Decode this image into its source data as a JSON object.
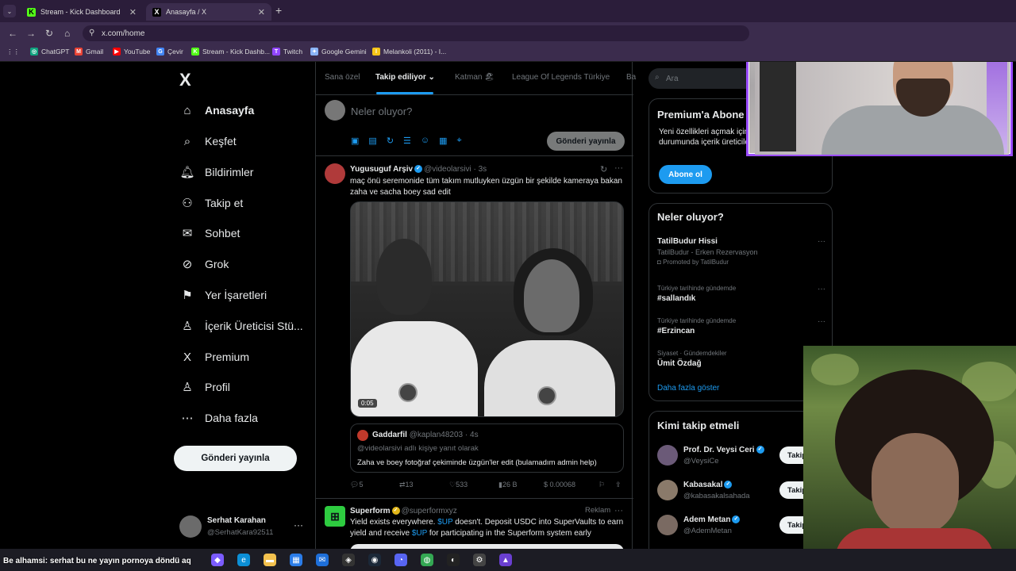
{
  "browser": {
    "tabs": [
      {
        "label": "Stream - Kick Dashboard",
        "fav_text": "K",
        "fav_color": "#53fc18"
      },
      {
        "label": "Anasayfa / X",
        "fav_text": "X",
        "fav_color": "#000000"
      }
    ],
    "new_tab": "+",
    "url": "x.com/home",
    "bookmarks": [
      {
        "label": "ChatGPT",
        "icon": "chatgpt-icon",
        "color": "#10a37f",
        "glyph": "◎"
      },
      {
        "label": "Gmail",
        "icon": "gmail-icon",
        "color": "#ea4335",
        "glyph": "M"
      },
      {
        "label": "YouTube",
        "icon": "youtube-icon",
        "color": "#ff0000",
        "glyph": "▶"
      },
      {
        "label": "Çevir",
        "icon": "translate-icon",
        "color": "#4285f4",
        "glyph": "G"
      },
      {
        "label": "Stream - Kick Dashb...",
        "icon": "kick-icon",
        "color": "#53fc18",
        "glyph": "K"
      },
      {
        "label": "Twitch",
        "icon": "twitch-icon",
        "color": "#9146ff",
        "glyph": "T"
      },
      {
        "label": "Google Gemini",
        "icon": "gemini-icon",
        "color": "#8ab4f8",
        "glyph": "✦"
      },
      {
        "label": "Melankoli (2011) - I...",
        "icon": "imdb-icon",
        "color": "#f5c518",
        "glyph": "I"
      }
    ]
  },
  "sidebar": {
    "logo": "X",
    "items": [
      {
        "label": "Anasayfa",
        "icon": "home-icon",
        "glyph": "⌂",
        "active": true
      },
      {
        "label": "Keşfet",
        "icon": "search-icon",
        "glyph": "⌕"
      },
      {
        "label": "Bildirimler",
        "icon": "bell-icon",
        "glyph": "🔔︎"
      },
      {
        "label": "Takip et",
        "icon": "add-person-icon",
        "glyph": "⚇"
      },
      {
        "label": "Sohbet",
        "icon": "mail-icon",
        "glyph": "✉"
      },
      {
        "label": "Grok",
        "icon": "grok-icon",
        "glyph": "⊘"
      },
      {
        "label": "Yer İşaretleri",
        "icon": "bookmark-icon",
        "glyph": "⚑"
      },
      {
        "label": "İçerik Üreticisi Stü...",
        "icon": "creator-studio-icon",
        "glyph": "♙"
      },
      {
        "label": "Premium",
        "icon": "x-premium-icon",
        "glyph": "X"
      },
      {
        "label": "Profil",
        "icon": "profile-icon",
        "glyph": "♙"
      },
      {
        "label": "Daha fazla",
        "icon": "more-circle-icon",
        "glyph": "⋯"
      }
    ],
    "post_button": "Gönderi yayınla",
    "account": {
      "name": "Serhat Karahan",
      "handle": "@SerhatKara92511"
    }
  },
  "timeline": {
    "tabs": [
      "Sana özel",
      "Takip ediliyor",
      "Katman 🏖",
      "League Of Legends Türkiye",
      "Ba"
    ],
    "active_tab": "Takip ediliyor",
    "compose": {
      "placeholder": "Neler oluyor?",
      "button": "Gönderi yayınla"
    },
    "tweet1": {
      "name": "Yugusuguf Arşiv",
      "handle": "@videolarsivi · 3s",
      "text": "maç önü seremonide tüm takım mutluyken üzgün bir şekilde kameraya bakan zaha ve sacha boey sad edit",
      "video_time": "0:05",
      "quote": {
        "name": "Gaddarfil",
        "handle": "@kaplan48203 · 4s",
        "reply_to": "@videolarsivi adlı kişiye yanıt olarak",
        "text": "Zaha ve boey fotoğraf çekiminde üzgün'ler edit (bulamadım admin help)"
      },
      "actions": {
        "replies": "5",
        "retweets": "13",
        "likes": "533",
        "views": "26 B",
        "tip": "$ 0.00068"
      }
    },
    "tweet2": {
      "name": "Superform",
      "handle": "@superformxyz",
      "ad_label": "Reklam",
      "text_parts": [
        "Yield exists everywhere. ",
        "$UP",
        " doesn't. Deposit USDC into SuperVaults to earn yield and receive ",
        "$UP",
        " for participating in the Superform system early"
      ]
    }
  },
  "right": {
    "search_placeholder": "Ara",
    "premium": {
      "title": "Premium'a Abone",
      "desc": "Yeni özellikleri açmak için abone olman durumunda içerik üreticileri kazan.",
      "button": "Abone ol"
    },
    "trends_title": "Neler oluyor?",
    "trends": [
      {
        "context": "",
        "title": "TatilBudur Hissi",
        "sub": "TatilBudur - Erken Rezervasyon",
        "promo": "Promoted by TatilBudur"
      },
      {
        "context": "Türkiye tarihinde gündemde",
        "title": "#sallandık",
        "sub": "",
        "promo": ""
      },
      {
        "context": "Türkiye tarihinde gündemde",
        "title": "#Erzincan",
        "sub": "",
        "promo": ""
      },
      {
        "context": "Siyaset · Gündemdekiler",
        "title": "Ümit Özdağ",
        "sub": "",
        "promo": ""
      }
    ],
    "show_more": "Daha fazla göster",
    "who_title": "Kimi takip etmeli",
    "who": [
      {
        "name": "Prof. Dr. Veysi Ceri",
        "handle": "@VeysiCe",
        "btn": "Takip et"
      },
      {
        "name": "Kabasakal",
        "handle": "@kabasakalsahada",
        "btn": "Takip et"
      },
      {
        "name": "Adem Metan",
        "handle": "@AdemMetan",
        "btn": "Takip et"
      }
    ]
  },
  "taskbar": {
    "ticker": "Be alhamsi: serhat bu ne yayın pornoya döndü aq",
    "apps": [
      {
        "icon": "copilot-icon",
        "color": "#7b5cff",
        "glyph": "◆"
      },
      {
        "icon": "edge-icon",
        "color": "#0c8fd6",
        "glyph": "e"
      },
      {
        "icon": "folder-icon",
        "color": "#f2c14e",
        "glyph": "▬"
      },
      {
        "icon": "store-icon",
        "color": "#2b7de9",
        "glyph": "▦"
      },
      {
        "icon": "mail-app-icon",
        "color": "#1e6fd9",
        "glyph": "✉"
      },
      {
        "icon": "app-icon",
        "color": "#333",
        "glyph": "◈"
      },
      {
        "icon": "steam-icon",
        "color": "#1b2838",
        "glyph": "◉"
      },
      {
        "icon": "discord-icon",
        "color": "#5865f2",
        "glyph": "◔"
      },
      {
        "icon": "chrome-icon",
        "color": "#34a853",
        "glyph": "◍"
      },
      {
        "icon": "obs-icon",
        "color": "#222",
        "glyph": "◐"
      },
      {
        "icon": "settings-icon",
        "color": "#444",
        "glyph": "⚙"
      },
      {
        "icon": "app2-icon",
        "color": "#6a3fd1",
        "glyph": "▲"
      }
    ]
  }
}
